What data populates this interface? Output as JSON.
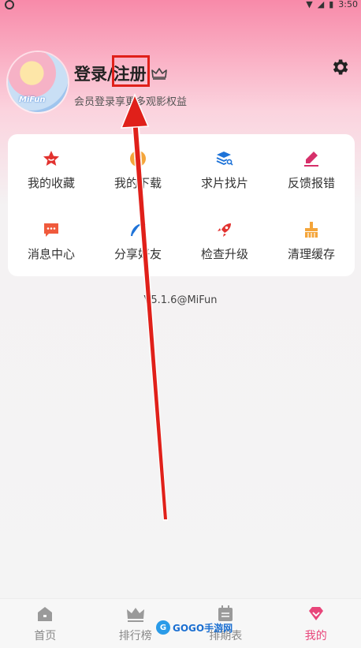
{
  "status": {
    "time": "3:50"
  },
  "profile": {
    "title": "登录/注册",
    "subtitle": "会员登录享更多观影权益",
    "avatar_tag": "MiFun"
  },
  "menu": [
    {
      "label": "我的收藏",
      "icon": "star-icon",
      "color": "#e2322f"
    },
    {
      "label": "我的下载",
      "icon": "download-icon",
      "color": "#f4a53a"
    },
    {
      "label": "求片找片",
      "icon": "search-stack-icon",
      "color": "#1e73d8"
    },
    {
      "label": "反馈报错",
      "icon": "edit-icon",
      "color": "#d6306a"
    },
    {
      "label": "消息中心",
      "icon": "message-icon",
      "color": "#f05a3c"
    },
    {
      "label": "分享好友",
      "icon": "share-icon",
      "color": "#1e73d8"
    },
    {
      "label": "检查升级",
      "icon": "rocket-icon",
      "color": "#e2322f"
    },
    {
      "label": "清理缓存",
      "icon": "broom-icon",
      "color": "#f4a53a"
    }
  ],
  "version": "V5.1.6@MiFun",
  "tabs": [
    {
      "label": "首页",
      "icon": "home-icon",
      "active": false
    },
    {
      "label": "排行榜",
      "icon": "crown-icon",
      "active": false
    },
    {
      "label": "排期表",
      "icon": "calendar-icon",
      "active": false
    },
    {
      "label": "我的",
      "icon": "heart-diamond-icon",
      "active": true
    }
  ],
  "watermark": "GOGO手游网",
  "colors": {
    "accent": "#e8457a",
    "highlight_red": "#e0201a"
  }
}
